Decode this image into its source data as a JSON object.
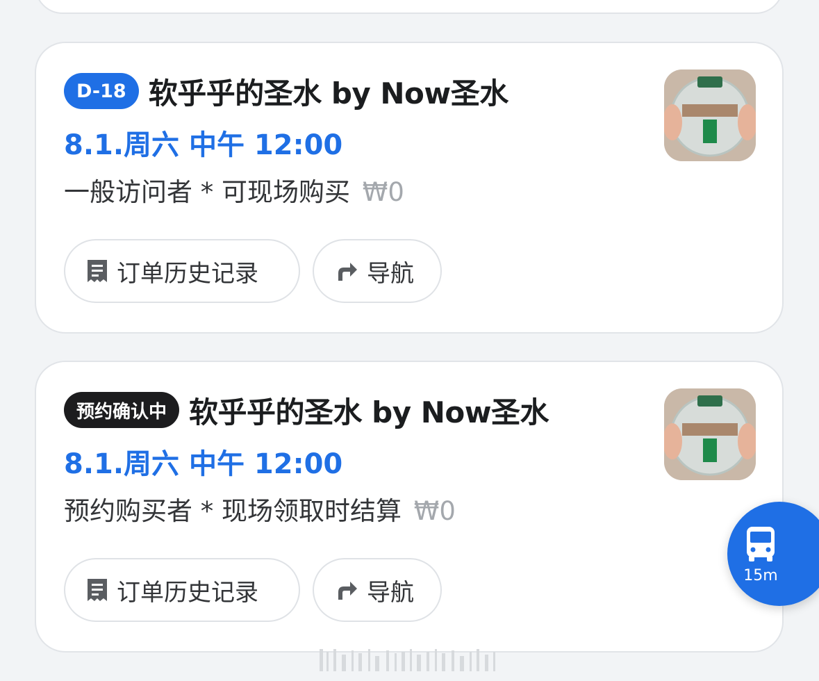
{
  "orders": [
    {
      "badge": "D-18",
      "badge_color": "#1f6fe5",
      "title": "软乎乎的圣水 by Now圣水",
      "date": "8.1.周六 中午 12:00",
      "desc": "一般访问者 * 可现场购买",
      "price": "₩0",
      "history_label": "订单历史记录",
      "nav_label": "导航"
    },
    {
      "badge": "预约确认中",
      "badge_color": "#1c1c1e",
      "title": "软乎乎的圣水 by Now圣水",
      "date": "8.1.周六 中午 12:00",
      "desc": "预约购买者 * 现场领取时结算",
      "price": "₩0",
      "history_label": "订单历史记录",
      "nav_label": "导航"
    }
  ],
  "fab": {
    "icon": "bus-icon",
    "label": "15m"
  },
  "colors": {
    "accent": "#1f6fe5",
    "badge_dark": "#1c1c1e",
    "background": "#f2f4f6"
  }
}
